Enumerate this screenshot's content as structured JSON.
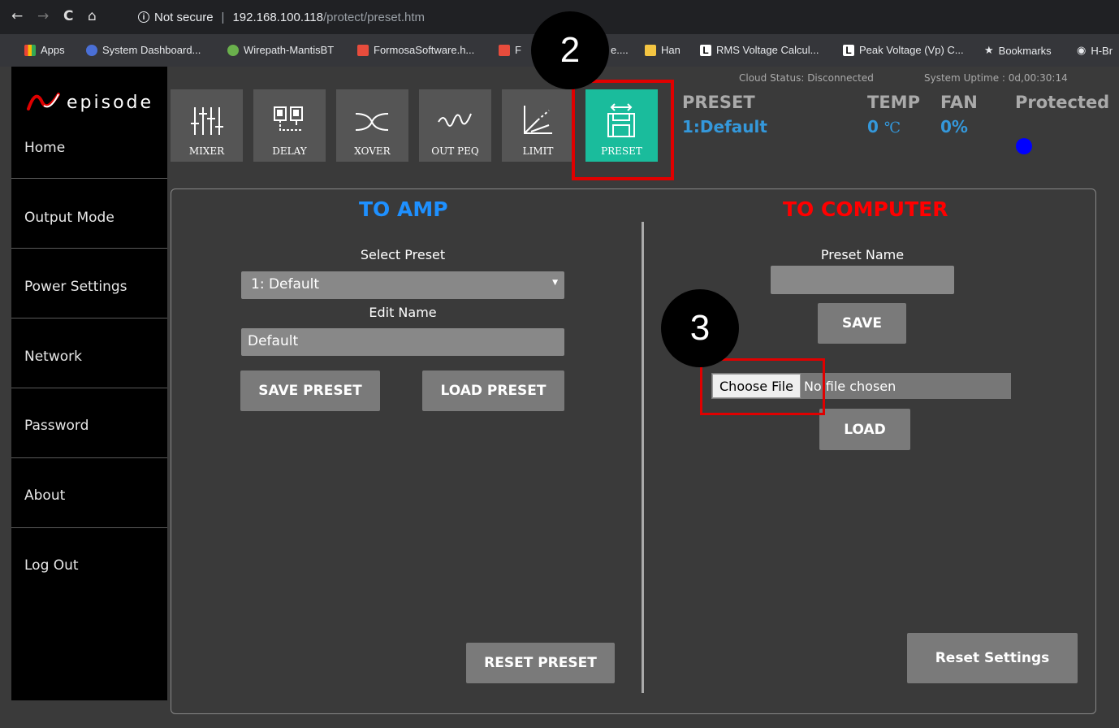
{
  "browser": {
    "security": "Not secure",
    "host": "192.168.100.118",
    "path": "/protect/preset.htm",
    "bookmarks": [
      "Apps",
      "System Dashboard...",
      "Wirepath-MantisBT",
      "FormosaSoftware.h...",
      "F",
      "e....",
      "Han",
      "RMS Voltage Calcul...",
      "Peak Voltage (Vp) C...",
      "Bookmarks",
      "H-Br"
    ]
  },
  "logo": {
    "text": "episode"
  },
  "sidebar": {
    "items": [
      {
        "label": "Home"
      },
      {
        "label": "Output Mode"
      },
      {
        "label": "Power Settings"
      },
      {
        "label": "Network"
      },
      {
        "label": "Password"
      },
      {
        "label": "About"
      },
      {
        "label": "Log Out"
      }
    ]
  },
  "toolbar": {
    "tiles": [
      {
        "label": "MIXER"
      },
      {
        "label": "DELAY"
      },
      {
        "label": "XOVER"
      },
      {
        "label": "OUT PEQ"
      },
      {
        "label": "LIMIT"
      },
      {
        "label": "PRESET"
      }
    ]
  },
  "status": {
    "cloud": "Cloud Status: Disconnected",
    "uptime": "System Uptime : 0d,00:30:14",
    "preset_label": "PRESET",
    "preset_value": "1:Default",
    "temp_label": "TEMP",
    "temp_value": "0",
    "temp_unit": "℃",
    "fan_label": "FAN",
    "fan_value": "0%",
    "protected_label": "Protected",
    "protected_color": "#0000ff"
  },
  "to_amp": {
    "title": "TO AMP",
    "select_label": "Select Preset",
    "selected": "1: Default",
    "edit_label": "Edit Name",
    "edit_value": "Default",
    "save_btn": "SAVE PRESET",
    "load_btn": "LOAD PRESET",
    "reset_btn": "RESET PRESET"
  },
  "to_computer": {
    "title": "TO COMPUTER",
    "name_label": "Preset Name",
    "name_value": "",
    "save_btn": "SAVE",
    "choose_btn": "Choose File",
    "no_file": "No file chosen",
    "load_btn": "LOAD",
    "reset_settings_btn": "Reset Settings"
  },
  "callouts": [
    "2",
    "3"
  ],
  "colors": {
    "accent_active": "#1abc9c",
    "to_amp_title": "#1e90ff",
    "to_computer_title": "#ff0000",
    "callout_border": "#e00000"
  }
}
